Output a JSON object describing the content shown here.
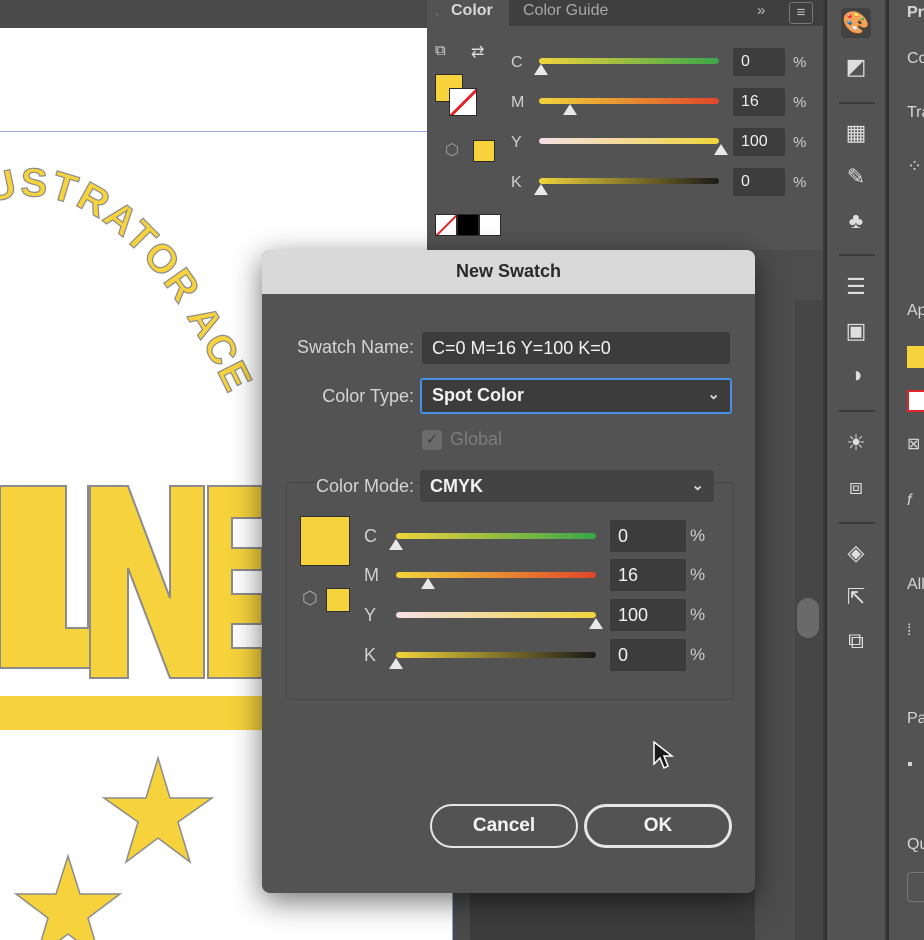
{
  "color_panel": {
    "tabs": [
      "Color",
      "Color Guide"
    ],
    "rows": [
      {
        "label": "C",
        "value": "0",
        "unit": "%",
        "level": 0
      },
      {
        "label": "M",
        "value": "16",
        "unit": "%",
        "level": 0.16
      },
      {
        "label": "Y",
        "value": "100",
        "unit": "%",
        "level": 1.0
      },
      {
        "label": "K",
        "value": "0",
        "unit": "%",
        "level": 0
      }
    ]
  },
  "dialog": {
    "title": "New Swatch",
    "swatch_name_label": "Swatch Name:",
    "swatch_name_value": "C=0 M=16 Y=100 K=0",
    "color_type_label": "Color Type:",
    "color_type_value": "Spot Color",
    "global_label": "Global",
    "global_checked": true,
    "color_mode_label": "Color Mode:",
    "color_mode_value": "CMYK",
    "rows": [
      {
        "label": "C",
        "value": "0",
        "unit": "%",
        "level": 0
      },
      {
        "label": "M",
        "value": "16",
        "unit": "%",
        "level": 0.16
      },
      {
        "label": "Y",
        "value": "100",
        "unit": "%",
        "level": 1.0
      },
      {
        "label": "K",
        "value": "0",
        "unit": "%",
        "level": 0
      }
    ],
    "cancel_label": "Cancel",
    "ok_label": "OK"
  },
  "artwork": {
    "arc_text": "USTRATOR ACES",
    "big_letters": "UNE"
  },
  "props_panel": {
    "labels": [
      "Pr",
      "Co",
      "Tra",
      "Ap",
      "All",
      "Pa",
      "Qu"
    ]
  },
  "colors": {
    "swatch_yellow": "#f6d33c",
    "accent_blue": "#4a8fe6"
  },
  "icons": [
    "cmyk-cube-icon",
    "swap-icon",
    "default-colors-icon",
    "chevron-down-icon",
    "color-palette-icon",
    "libraries-icon",
    "swatches-grid-icon",
    "brushes-icon",
    "symbols-icon",
    "stroke-icon",
    "gradient-icon",
    "transparency-icon",
    "appearance-icon",
    "graphic-styles-icon",
    "layers-icon",
    "export-icon",
    "artboards-icon"
  ]
}
